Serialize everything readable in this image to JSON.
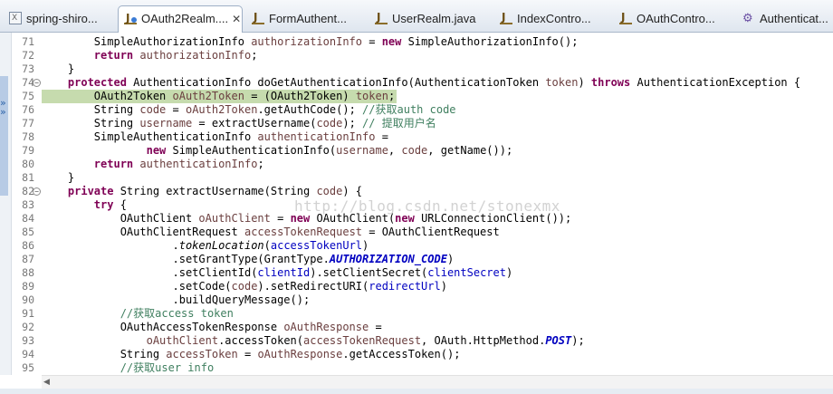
{
  "tabs": [
    {
      "label": "spring-shiro...",
      "icon": "xml-file-icon",
      "active": false
    },
    {
      "label": "OAuth2Realm....",
      "icon": "java-file-icon",
      "active": true,
      "close": "✕"
    },
    {
      "label": "FormAuthent...",
      "icon": "java-file-icon",
      "active": false
    },
    {
      "label": "UserRealm.java",
      "icon": "java-file-icon",
      "active": false
    },
    {
      "label": "IndexContro...",
      "icon": "java-file-icon",
      "active": false
    },
    {
      "label": "OAuthContro...",
      "icon": "java-file-icon",
      "active": false
    },
    {
      "label": "Authenticat...",
      "icon": "test-file-icon",
      "active": false
    }
  ],
  "editor": {
    "current_line": 75,
    "watermark": "http://blog.csdn.net/stonexmx",
    "lines": [
      {
        "n": "71",
        "segs": [
          [
            "",
            "        SimpleAuthorizationInfo "
          ],
          [
            "p",
            "authorizationInfo"
          ],
          [
            "",
            " = "
          ],
          [
            "k",
            "new"
          ],
          [
            "",
            " SimpleAuthorizationInfo();"
          ]
        ]
      },
      {
        "n": "72",
        "segs": [
          [
            "",
            "        "
          ],
          [
            "k",
            "return"
          ],
          [
            "",
            " "
          ],
          [
            "p",
            "authorizationInfo"
          ],
          [
            "",
            ";"
          ]
        ]
      },
      {
        "n": "73",
        "segs": [
          [
            "",
            "    }"
          ]
        ]
      },
      {
        "n": "74",
        "segs": [
          [
            "",
            "    "
          ],
          [
            "k",
            "protected"
          ],
          [
            "",
            " AuthenticationInfo doGetAuthenticationInfo(AuthenticationToken "
          ],
          [
            "p",
            "token"
          ],
          [
            "",
            ") "
          ],
          [
            "k",
            "throws"
          ],
          [
            "",
            " AuthenticationException {"
          ]
        ]
      },
      {
        "n": "75",
        "segs": [
          [
            "",
            "        OAuth2Token "
          ],
          [
            "p",
            "oAuth2Token"
          ],
          [
            "",
            " = (OAuth2Token) "
          ],
          [
            "p",
            "token"
          ],
          [
            "",
            ";"
          ]
        ]
      },
      {
        "n": "76",
        "segs": [
          [
            "",
            "        String "
          ],
          [
            "p",
            "code"
          ],
          [
            "",
            " = "
          ],
          [
            "p",
            "oAuth2Token"
          ],
          [
            "",
            ".getAuthCode(); "
          ],
          [
            "c",
            "//获取auth code"
          ]
        ]
      },
      {
        "n": "77",
        "segs": [
          [
            "",
            "        String "
          ],
          [
            "p",
            "username"
          ],
          [
            "",
            " = extractUsername("
          ],
          [
            "p",
            "code"
          ],
          [
            "",
            "); "
          ],
          [
            "c",
            "// 提取用户名"
          ]
        ]
      },
      {
        "n": "78",
        "segs": [
          [
            "",
            "        SimpleAuthenticationInfo "
          ],
          [
            "p",
            "authenticationInfo"
          ],
          [
            "",
            " ="
          ]
        ]
      },
      {
        "n": "79",
        "segs": [
          [
            "",
            "                "
          ],
          [
            "k",
            "new"
          ],
          [
            "",
            " SimpleAuthenticationInfo("
          ],
          [
            "p",
            "username"
          ],
          [
            "",
            ", "
          ],
          [
            "p",
            "code"
          ],
          [
            "",
            ", getName());"
          ]
        ]
      },
      {
        "n": "80",
        "segs": [
          [
            "",
            "        "
          ],
          [
            "k",
            "return"
          ],
          [
            "",
            " "
          ],
          [
            "p",
            "authenticationInfo"
          ],
          [
            "",
            ";"
          ]
        ]
      },
      {
        "n": "81",
        "segs": [
          [
            "",
            "    }"
          ]
        ]
      },
      {
        "n": "82",
        "segs": [
          [
            "",
            "    "
          ],
          [
            "k",
            "private"
          ],
          [
            "",
            " String extractUsername(String "
          ],
          [
            "p",
            "code"
          ],
          [
            "",
            ") {"
          ]
        ]
      },
      {
        "n": "83",
        "segs": [
          [
            "",
            "        "
          ],
          [
            "k",
            "try"
          ],
          [
            "",
            " {"
          ]
        ]
      },
      {
        "n": "84",
        "segs": [
          [
            "",
            "            OAuthClient "
          ],
          [
            "p",
            "oAuthClient"
          ],
          [
            "",
            " = "
          ],
          [
            "k",
            "new"
          ],
          [
            "",
            " OAuthClient("
          ],
          [
            "k",
            "new"
          ],
          [
            "",
            " URLConnectionClient());"
          ]
        ]
      },
      {
        "n": "85",
        "segs": [
          [
            "",
            "            OAuthClientRequest "
          ],
          [
            "p",
            "accessTokenRequest"
          ],
          [
            "",
            " = OAuthClientRequest"
          ]
        ]
      },
      {
        "n": "86",
        "segs": [
          [
            "",
            "                    ."
          ],
          [
            "it",
            "tokenLocation"
          ],
          [
            "",
            "("
          ],
          [
            "f",
            "accessTokenUrl"
          ],
          [
            "",
            ")"
          ]
        ]
      },
      {
        "n": "87",
        "segs": [
          [
            "",
            "                    .setGrantType(GrantType."
          ],
          [
            "st",
            "AUTHORIZATION_CODE"
          ],
          [
            "",
            ")"
          ]
        ]
      },
      {
        "n": "88",
        "segs": [
          [
            "",
            "                    .setClientId("
          ],
          [
            "f",
            "clientId"
          ],
          [
            "",
            ").setClientSecret("
          ],
          [
            "f",
            "clientSecret"
          ],
          [
            "",
            ")"
          ]
        ]
      },
      {
        "n": "89",
        "segs": [
          [
            "",
            "                    .setCode("
          ],
          [
            "p",
            "code"
          ],
          [
            "",
            ").setRedirectURI("
          ],
          [
            "f",
            "redirectUrl"
          ],
          [
            "",
            ")"
          ]
        ]
      },
      {
        "n": "90",
        "segs": [
          [
            "",
            "                    .buildQueryMessage();"
          ]
        ]
      },
      {
        "n": "91",
        "segs": [
          [
            "",
            "            "
          ],
          [
            "c",
            "//获取access token"
          ]
        ]
      },
      {
        "n": "92",
        "segs": [
          [
            "",
            "            OAuthAccessTokenResponse "
          ],
          [
            "p",
            "oAuthResponse"
          ],
          [
            "",
            " ="
          ]
        ]
      },
      {
        "n": "93",
        "segs": [
          [
            "",
            "                "
          ],
          [
            "p",
            "oAuthClient"
          ],
          [
            "",
            ".accessToken("
          ],
          [
            "p",
            "accessTokenRequest"
          ],
          [
            "",
            ", OAuth.HttpMethod."
          ],
          [
            "st",
            "POST"
          ],
          [
            "",
            ");"
          ]
        ]
      },
      {
        "n": "94",
        "segs": [
          [
            "",
            "            String "
          ],
          [
            "p",
            "accessToken"
          ],
          [
            "",
            " = "
          ],
          [
            "p",
            "oAuthResponse"
          ],
          [
            "",
            ".getAccessToken();"
          ]
        ]
      },
      {
        "n": "95",
        "segs": [
          [
            "",
            "            "
          ],
          [
            "c",
            "//获取user info"
          ]
        ]
      }
    ]
  }
}
